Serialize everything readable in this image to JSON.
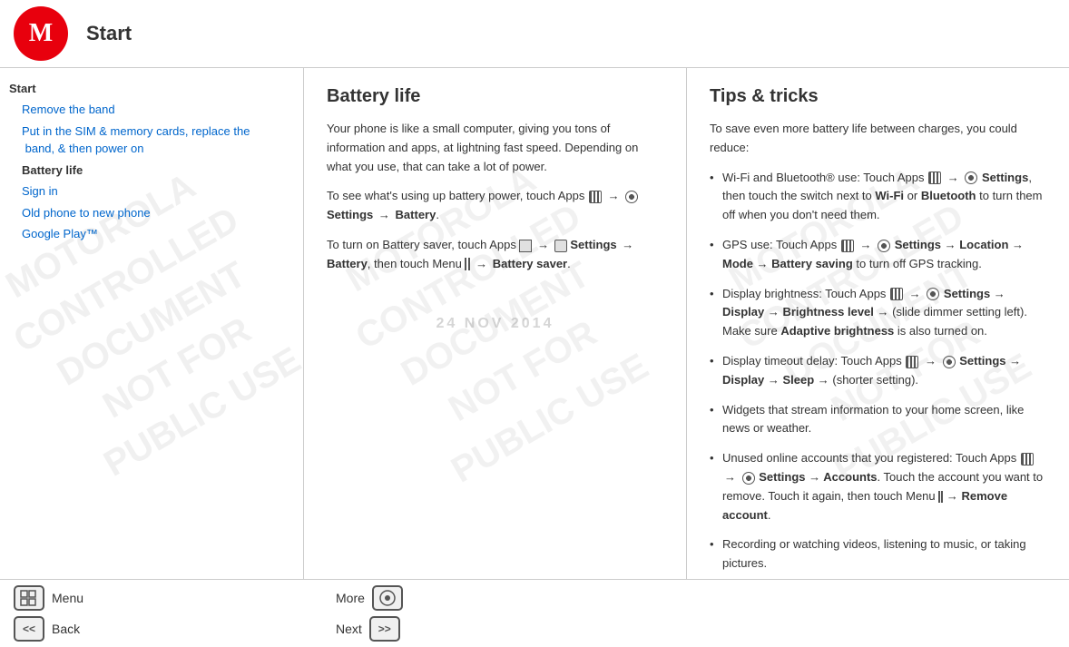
{
  "header": {
    "logo_alt": "Motorola",
    "title": "Start"
  },
  "sidebar": {
    "section_title": "Start",
    "nav_items": [
      {
        "label": "Remove the band",
        "bold": false
      },
      {
        "label": "Put in the SIM & memory cards, replace the band, & then power on",
        "bold": false
      },
      {
        "label": "Battery life",
        "bold": true
      },
      {
        "label": "Sign in",
        "bold": false
      },
      {
        "label": "Old phone to new phone",
        "bold": false
      },
      {
        "label": "Google Play™",
        "bold": false
      }
    ]
  },
  "watermark": {
    "text_lines": [
      "MOTOROLA\nCONTROLLED\nDOCUMENT\nNOT FOR\nPUBLIC USE"
    ],
    "date": "24 NOV 2014"
  },
  "battery_panel": {
    "title": "Battery life",
    "paragraphs": [
      "Your phone is like a small computer, giving you tons of information and apps, at lightning fast speed. Depending on what you use, that can take a lot of power.",
      "To see what's using up battery power, touch Apps",
      "→ Settings → Battery.",
      "To turn on Battery saver, touch Apps",
      "→ Settings → Battery, then touch Menu",
      "→ Battery saver."
    ]
  },
  "tips_panel": {
    "title": "Tips & tricks",
    "intro": "To save even more battery life between charges, you could reduce:",
    "tips": [
      "Wi-Fi and Bluetooth® use: Touch Apps → Settings, then touch the switch next to Wi-Fi or Bluetooth to turn them off when you don't need them.",
      "GPS use: Touch Apps → Settings → Location → Mode → Battery saving to turn off GPS tracking.",
      "Display brightness: Touch Apps → Settings → Display → Brightness level → (slide dimmer setting left). Make sure Adaptive brightness is also turned on.",
      "Display timeout delay: Touch Apps → Settings → Display → Sleep → (shorter setting).",
      "Widgets that stream information to your home screen, like news or weather.",
      "Unused online accounts that you registered: Touch Apps → Settings → Accounts. Touch the account you want to remove. Touch it again, then touch Menu → Remove account.",
      "Recording or watching videos, listening to music, or taking pictures."
    ]
  },
  "toolbar": {
    "menu_label": "Menu",
    "more_label": "More",
    "back_label": "Back",
    "next_label": "Next",
    "menu_icon_grid": "⊞",
    "back_icon": "<<",
    "more_icon": "⊙",
    "next_icon": ">>"
  }
}
